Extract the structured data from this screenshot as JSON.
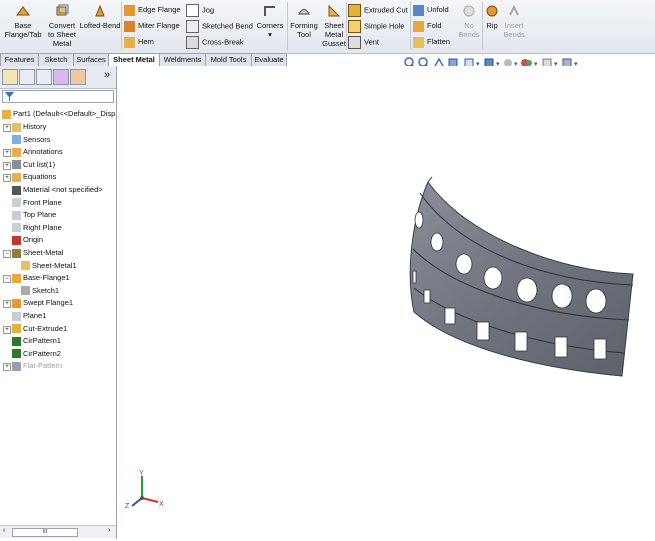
{
  "ribbon": {
    "base_flange": {
      "line1": "Base",
      "line2": "Flange/Tab"
    },
    "convert": {
      "line1": "Convert",
      "line2": "to Sheet",
      "line3": "Metal"
    },
    "lofted_bend": "Lofted-Bend",
    "edge_flange": "Edge Flange",
    "miter_flange": "Miter Flange",
    "hem": "Hem",
    "jog": "Jog",
    "sketched_bend": "Sketched Bend",
    "cross_break": "Cross-Break",
    "corners": "Corners",
    "forming_tool": {
      "line1": "Forming",
      "line2": "Tool"
    },
    "sheet_metal_gusset": {
      "line1": "Sheet",
      "line2": "Metal",
      "line3": "Gusset"
    },
    "extruded_cut": "Extruded Cut",
    "simple_hole": "Simple Hole",
    "vent": "Vent",
    "unfold": "Unfold",
    "fold": "Fold",
    "flatten": "Flatten",
    "no_bends": {
      "line1": "No",
      "line2": "Bends"
    },
    "rip": "Rip",
    "insert_bends": {
      "line1": "Insert",
      "line2": "Bends"
    }
  },
  "tabs": [
    "Features",
    "Sketch",
    "Surfaces",
    "Sheet Metal",
    "Weldments",
    "Mold Tools",
    "Evaluate"
  ],
  "active_tab": "Sheet Metal",
  "tree": {
    "root": "Part1  (Default<<Default>_Disp",
    "items": [
      "History",
      "Sensors",
      "Annotations",
      "Cut list(1)",
      "Equations",
      "Material <not specified>",
      "Front Plane",
      "Top Plane",
      "Right Plane",
      "Origin",
      "Sheet-Metal",
      "Sheet-Metal1",
      "Base-Flange1",
      "Sketch1",
      "Swept Flange1",
      "Plane1",
      "Cut-Extrude1",
      "CirPattern1",
      "CirPattern2",
      "Flat-Pattern"
    ]
  },
  "fm_more": "»",
  "scroll_thumb": "III",
  "triad": {
    "x": "X",
    "y": "Y",
    "z": "Z"
  },
  "colors": {
    "part": "#7d818c",
    "accent": "#1f4e9c"
  }
}
